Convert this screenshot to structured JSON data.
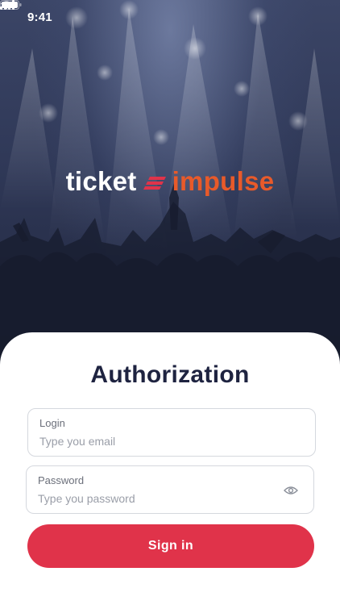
{
  "status_bar": {
    "time": "9:41",
    "icons": [
      "signal-icon",
      "wifi-icon",
      "battery-icon"
    ]
  },
  "brand": {
    "name_left": "ticket",
    "name_right": "impulse",
    "colors": {
      "left": "#ffffff",
      "mark": "#e0334a",
      "right": "#e85a2a"
    }
  },
  "hero": {
    "image": "concert-crowd-background",
    "tint": "#2f3857"
  },
  "auth": {
    "title": "Authorization",
    "login": {
      "label": "Login",
      "placeholder": "Type you email",
      "value": ""
    },
    "password": {
      "label": "Password",
      "placeholder": "Type you password",
      "value": "",
      "icon": "eye-icon"
    },
    "sign_in_label": "Sign in"
  },
  "colors": {
    "accent": "#e0334a",
    "title": "#1e2340",
    "field_border": "#d5d8de"
  }
}
